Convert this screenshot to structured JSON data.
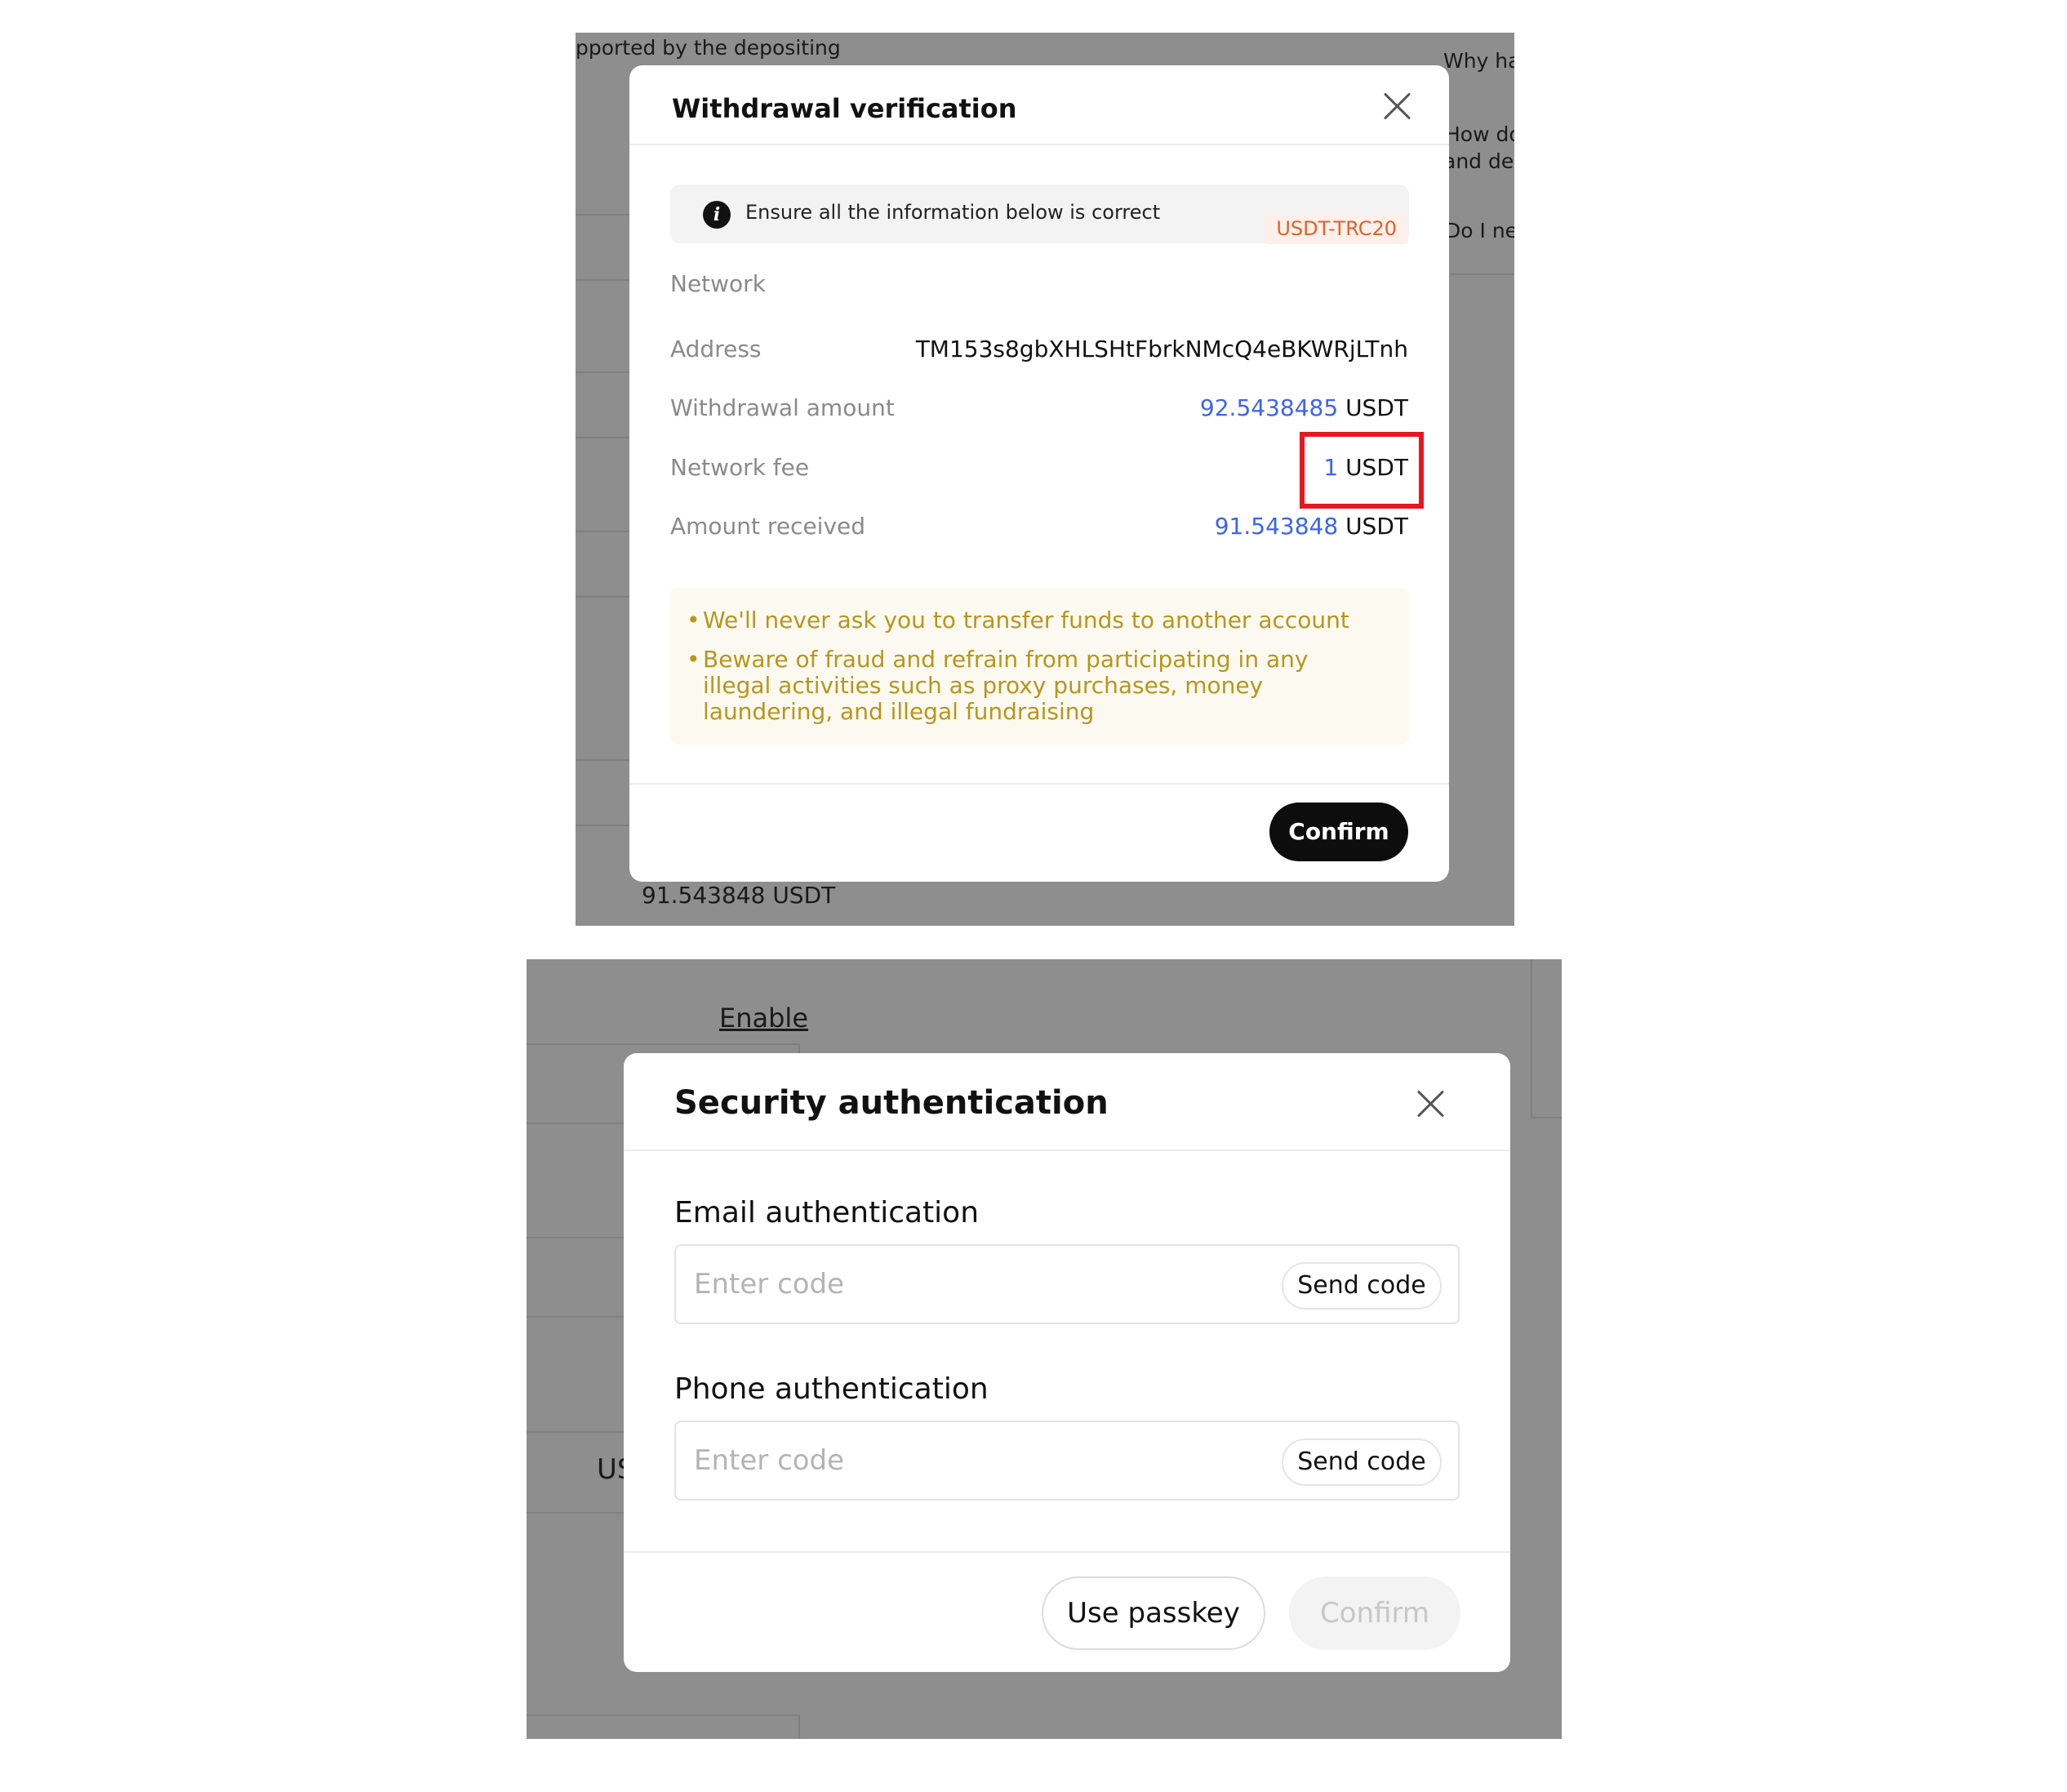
{
  "top_panel": {
    "background_texts": {
      "depositing_note": "pported by the depositing",
      "faq_1": "Why ha",
      "faq_2_line1": "How do",
      "faq_2_line2": "and dep",
      "faq_3": "Do I nee",
      "received_total": "91.543848 USDT"
    },
    "modal": {
      "title": "Withdrawal verification",
      "info_text": "Ensure all the information below is correct",
      "rows": {
        "network_label": "Network",
        "network_value": "USDT-TRC20",
        "address_label": "Address",
        "address_value": "TM153s8gbXHLSHtFbrkNMcQ4eBKWRjLTnh",
        "withdrawal_label": "Withdrawal amount",
        "withdrawal_amount": "92.5438485",
        "withdrawal_unit": "USDT",
        "fee_label": "Network fee",
        "fee_amount": "1",
        "fee_unit": "USDT",
        "received_label": "Amount received",
        "received_amount": "91.543848",
        "received_unit": "USDT"
      },
      "warnings": {
        "bullet": "•",
        "warning_1": "We'll never ask you to transfer funds to another account",
        "warning_2": "Beware of fraud and refrain from participating in any illegal activities such as proxy purchases, money laundering, and illegal fundraising"
      },
      "confirm_label": "Confirm"
    }
  },
  "bottom_panel": {
    "background_texts": {
      "enable_link": "Enable",
      "partial_us": "US"
    },
    "modal": {
      "title": "Security authentication",
      "email_label": "Email authentication",
      "email_placeholder": "Enter code",
      "email_send": "Send code",
      "phone_label": "Phone authentication",
      "phone_placeholder": "Enter code",
      "phone_send": "Send code",
      "passkey_label": "Use passkey",
      "confirm_label": "Confirm"
    }
  },
  "colors": {
    "overlay": "#8e8e8e",
    "accent_blue": "#3d63f0",
    "network_badge": "#e0622a",
    "warning_text": "#b8951e",
    "highlight_red": "#e3191e"
  }
}
